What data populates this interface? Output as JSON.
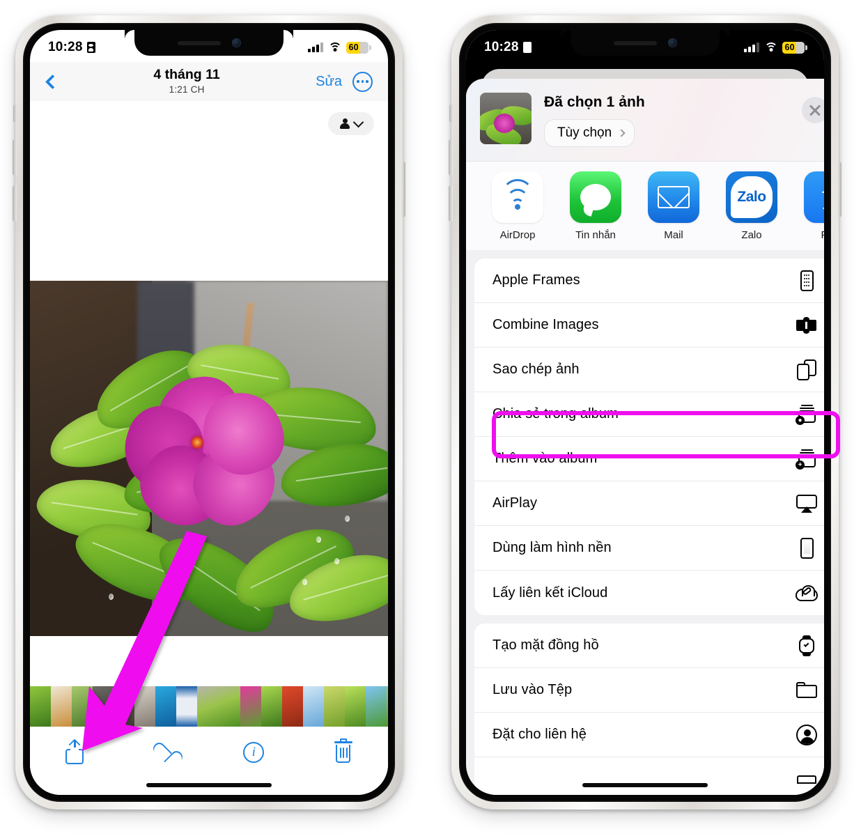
{
  "accent": {
    "ios_blue": "#1f83e0",
    "highlight_magenta": "#ef0fef",
    "battery_yellow": "#ffd60a"
  },
  "left_phone": {
    "status_bar": {
      "time": "10:28",
      "battery_percent": "60"
    },
    "nav_bar": {
      "back_icon": "chevron-left-icon",
      "title": "4 tháng 11",
      "subtitle": "1:21 CH",
      "edit_label": "Sửa",
      "more_icon": "ellipsis-circle-icon"
    },
    "people_pill": {
      "icon": "person-icon",
      "chevron": "chevron-down-icon"
    },
    "toolbar": [
      {
        "name": "share",
        "icon": "share-icon"
      },
      {
        "name": "favorite",
        "icon": "heart-icon"
      },
      {
        "name": "info",
        "icon": "info-circle-icon"
      },
      {
        "name": "delete",
        "icon": "trash-icon"
      }
    ]
  },
  "right_phone": {
    "status_bar": {
      "time": "10:28",
      "battery_percent": "60"
    },
    "share_sheet": {
      "selection_title": "Đã chọn 1 ảnh",
      "options_label": "Tùy chọn",
      "close_icon": "close-icon",
      "apps": [
        {
          "label": "AirDrop",
          "icon": "airdrop-icon"
        },
        {
          "label": "Tin nhắn",
          "icon": "messages-icon"
        },
        {
          "label": "Mail",
          "icon": "mail-icon"
        },
        {
          "label": "Zalo",
          "icon": "zalo-icon",
          "wordmark": "Zalo"
        },
        {
          "label": "Fac",
          "icon": "facebook-icon"
        }
      ],
      "menu_groups": [
        {
          "items": [
            {
              "label": "Apple Frames",
              "icon": "iphone-frame-icon",
              "highlighted": false
            },
            {
              "label": "Combine Images",
              "icon": "puzzle-icon",
              "highlighted": false
            },
            {
              "label": "Sao chép ảnh",
              "icon": "copy-icon",
              "highlighted": false
            },
            {
              "label": "Chia sẻ trong album",
              "icon": "shared-album-icon",
              "highlighted": true
            },
            {
              "label": "Thêm vào album",
              "icon": "add-to-album-icon",
              "highlighted": false
            },
            {
              "label": "AirPlay",
              "icon": "airplay-icon",
              "highlighted": false
            },
            {
              "label": "Dùng làm hình nền",
              "icon": "wallpaper-icon",
              "highlighted": false
            },
            {
              "label": "Lấy liên kết iCloud",
              "icon": "icloud-link-icon",
              "highlighted": false
            }
          ]
        },
        {
          "items": [
            {
              "label": "Tạo mặt đồng hồ",
              "icon": "watch-face-icon",
              "highlighted": false
            },
            {
              "label": "Lưu vào Tệp",
              "icon": "folder-icon",
              "highlighted": false
            },
            {
              "label": "Đặt cho liên hệ",
              "icon": "contact-icon",
              "highlighted": false
            },
            {
              "label": "",
              "icon": "printer-icon",
              "highlighted": false
            }
          ]
        }
      ]
    }
  },
  "annotation": {
    "arrow_color": "#ef0fef",
    "arrow_from": "photo-area",
    "arrow_to": "share-button"
  }
}
